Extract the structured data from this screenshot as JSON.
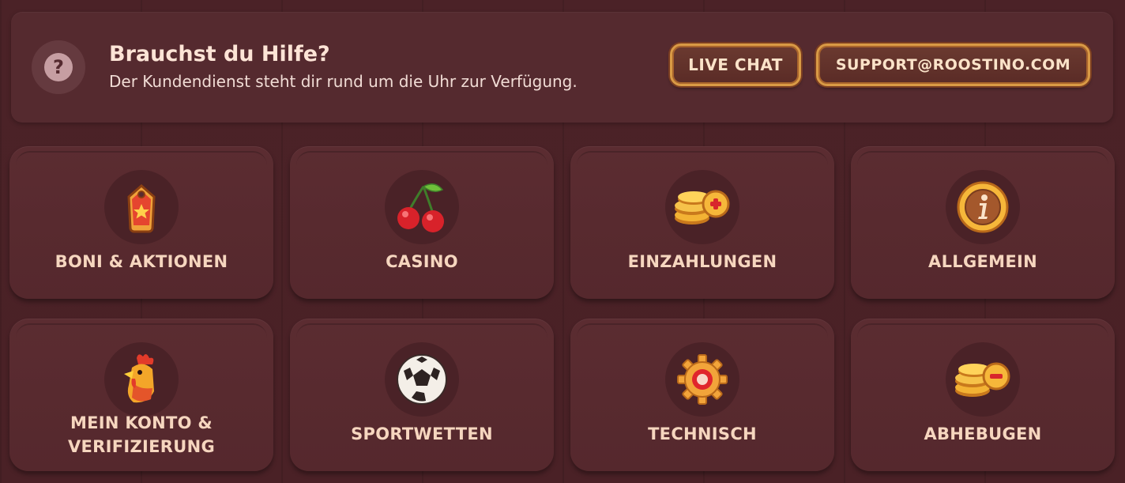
{
  "help": {
    "title": "Brauchst du Hilfe?",
    "subtitle": "Der Kundendienst steht dir rund um die Uhr zur Verfügung.",
    "icon": "question-icon",
    "buttons": {
      "live_chat": "LIVE CHAT",
      "email": "SUPPORT@ROOSTINO.COM"
    }
  },
  "categories": [
    {
      "label": "BONI & AKTIONEN",
      "icon": "price-tag-icon"
    },
    {
      "label": "CASINO",
      "icon": "cherries-icon"
    },
    {
      "label": "EINZAHLUNGEN",
      "icon": "coins-plus-icon"
    },
    {
      "label": "ALLGEMEIN",
      "icon": "info-coin-icon"
    },
    {
      "label_line1": "MEIN KONTO &",
      "label_line2": "VERIFIZIERUNG",
      "icon": "rooster-icon"
    },
    {
      "label": "SPORTWETTEN",
      "icon": "soccer-ball-icon"
    },
    {
      "label": "TECHNISCH",
      "icon": "gear-icon"
    },
    {
      "label": "ABHEBUGEN",
      "icon": "coins-minus-icon"
    }
  ],
  "colors": {
    "background": "#4a2126",
    "panel": "#552a2f",
    "card": "#5a2b30",
    "label": "#f6d6bf",
    "button_border": "#d99a45"
  }
}
